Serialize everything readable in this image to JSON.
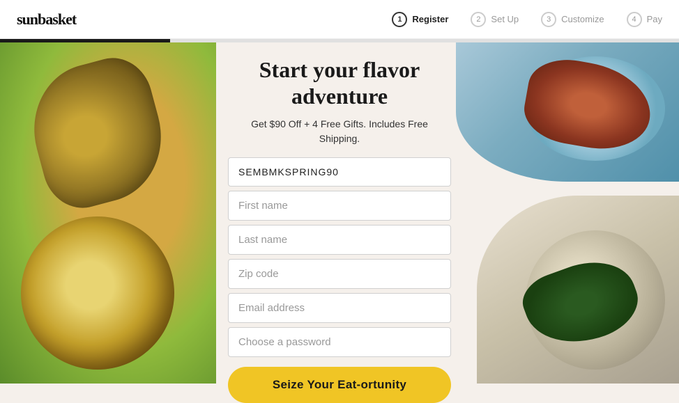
{
  "header": {
    "logo": "sunbasket",
    "steps": [
      {
        "number": "1",
        "label": "Register",
        "active": true
      },
      {
        "number": "2",
        "label": "Set Up",
        "active": false
      },
      {
        "number": "3",
        "label": "Customize",
        "active": false
      },
      {
        "number": "4",
        "label": "Pay",
        "active": false
      }
    ]
  },
  "hero": {
    "headline_line1": "Start your flavor",
    "headline_line2": "adventure",
    "subheadline": "Get $90 Off + 4 Free Gifts. Includes Free Shipping."
  },
  "form": {
    "promo_code": "SEMBMKSPRING90",
    "first_name_placeholder": "First name",
    "last_name_placeholder": "Last name",
    "zip_placeholder": "Zip code",
    "email_placeholder": "Email address",
    "password_placeholder": "Choose a password",
    "cta_label": "Seize Your Eat-ortunity"
  }
}
